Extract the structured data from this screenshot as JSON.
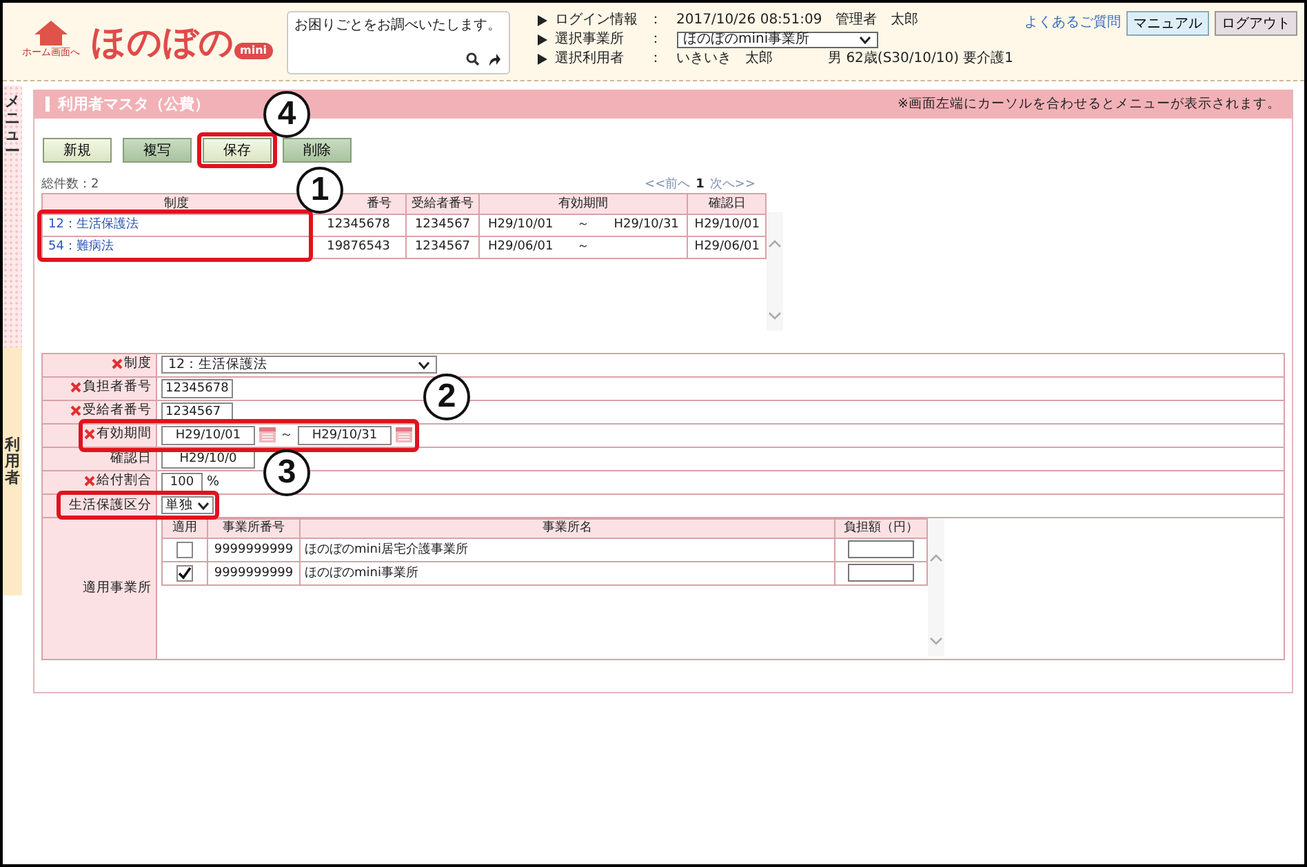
{
  "header": {
    "home_label": "ホーム画面へ",
    "logo_text": "ほのぼの",
    "logo_badge": "mini",
    "search": {
      "value": "お困りごとをお調べいたします。"
    },
    "info": [
      {
        "kind": "text",
        "label": "ログイン情報",
        "colon": "：",
        "value": "2017/10/26 08:51:09　管理者　太郎"
      },
      {
        "kind": "select",
        "label": "選択事業所",
        "colon": "：",
        "value": "ほのぼのmini事業所"
      },
      {
        "kind": "text",
        "label": "選択利用者",
        "colon": "：",
        "value": "いきいき　太郎",
        "extra": "男 62歳(S30/10/10) 要介護1"
      }
    ],
    "faq": "よくあるご質問",
    "manual": "マニュアル",
    "logout": "ログアウト"
  },
  "side_tabs": [
    {
      "label": "メニュー",
      "kind": "menu"
    },
    {
      "label": "利用者",
      "kind": "user"
    }
  ],
  "page": {
    "title": "利用者マスタ（公費）",
    "hint": "※画面左端にカーソルを合わせるとメニューが表示されます。"
  },
  "buttons": [
    {
      "label": "新規",
      "disabled": false
    },
    {
      "label": "複写",
      "disabled": true
    },
    {
      "label": "保存",
      "disabled": false
    },
    {
      "label": "削除",
      "disabled": true
    }
  ],
  "list": {
    "total": "総件数：2",
    "pager": {
      "prev": "<<前へ",
      "page": "1",
      "next": "次へ>>"
    },
    "columns": [
      "制度",
      "番号",
      "受給者番号",
      "有効期間",
      "確認日"
    ],
    "rows": [
      {
        "seido": "12：生活保護法",
        "payer": "12345678",
        "recipient": "1234567",
        "from": "H29/10/01",
        "sep": "～",
        "to": "H29/10/31",
        "confirmed": "H29/10/01"
      },
      {
        "seido": "54：難病法",
        "payer": "19876543",
        "recipient": "1234567",
        "from": "H29/06/01",
        "sep": "～",
        "confirmed": "H29/06/01"
      }
    ]
  },
  "form": {
    "fields": [
      {
        "kind": "select",
        "label": "制度",
        "required": true,
        "value": "12：生活保護法"
      },
      {
        "kind": "text",
        "label": "負担者番号",
        "required": true,
        "value": "12345678"
      },
      {
        "kind": "text",
        "label": "受給者番号",
        "required": true,
        "value": "1234567"
      },
      {
        "kind": "period",
        "label": "有効期間",
        "required": true,
        "from": "H29/10/01",
        "sep": "～",
        "to": "H29/10/31"
      },
      {
        "kind": "date",
        "label": "確認日",
        "required": false,
        "value": "H29/10/0"
      },
      {
        "kind": "percent",
        "label": "給付割合",
        "required": true,
        "value": "100",
        "unit": "%"
      },
      {
        "kind": "small-select",
        "label": "生活保護区分",
        "required": false,
        "value": "単独"
      }
    ],
    "offices": {
      "label": "適用事業所",
      "columns": [
        "適用",
        "事業所番号",
        "事業所名",
        "負担額（円）"
      ],
      "rows": [
        {
          "checked": false,
          "number": "9999999999",
          "name": "ほのぼのmini居宅介護事業所"
        },
        {
          "checked": true,
          "number": "9999999999",
          "name": "ほのぼのmini事業所"
        }
      ]
    }
  },
  "callouts": [
    {
      "number": "4"
    },
    {
      "number": "1"
    },
    {
      "number": "2"
    },
    {
      "number": "3"
    }
  ]
}
